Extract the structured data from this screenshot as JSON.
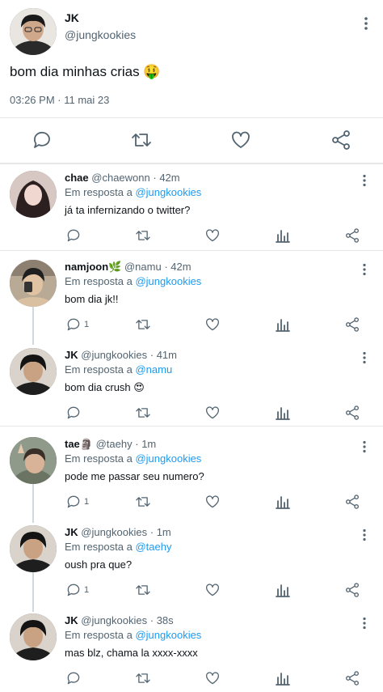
{
  "main_tweet": {
    "name": "JK",
    "handle": "@jungkookies",
    "text": "bom dia minhas crias 🤑",
    "time": "03:26 PM",
    "separator": "·",
    "date": "11 mai 23"
  },
  "replying_label": "Em resposta a",
  "replies": [
    {
      "name": "chae",
      "handle": "@chaewonn",
      "time": "42m",
      "reply_to": "@jungkookies",
      "text": "já ta infernizando o twitter?",
      "reply_count": ""
    },
    {
      "name": "namjoon🌿",
      "handle": "@namu",
      "time": "42m",
      "reply_to": "@jungkookies",
      "text": "bom dia jk!!",
      "reply_count": "1"
    },
    {
      "name": "JK",
      "handle": "@jungkookies",
      "time": "41m",
      "reply_to": "@namu",
      "text": "bom dia crush 😍",
      "reply_count": ""
    },
    {
      "name": "tae🗿",
      "handle": "@taehy",
      "time": "1m",
      "reply_to": "@jungkookies",
      "text": "pode me passar seu numero?",
      "reply_count": "1"
    },
    {
      "name": "JK",
      "handle": "@jungkookies",
      "time": "1m",
      "reply_to": "@taehy",
      "text": "oush pra que?",
      "reply_count": "1"
    },
    {
      "name": "JK",
      "handle": "@jungkookies",
      "time": "38s",
      "reply_to": "@jungkookies",
      "text": "mas blz, chama la xxxx-xxxx",
      "reply_count": ""
    }
  ],
  "icons": [
    "reply-icon",
    "retweet-icon",
    "like-icon",
    "analytics-icon",
    "share-icon",
    "more-icon"
  ],
  "colors": {
    "link": "#1d9bf0",
    "muted": "#536471",
    "divider": "#e6e6e6"
  }
}
